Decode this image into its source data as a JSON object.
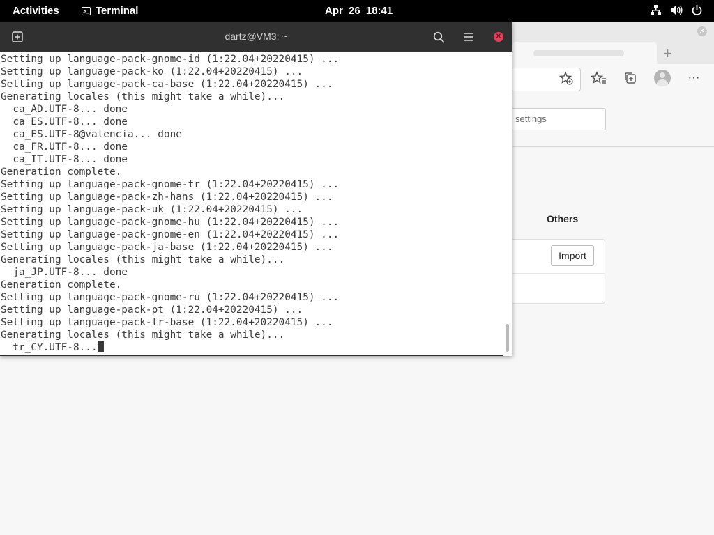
{
  "topbar": {
    "activities": "Activities",
    "app_name": "Terminal",
    "clock": "Apr 26  18:41"
  },
  "browser": {
    "search_placeholder": "settings",
    "section_label": "Others",
    "import_label": "Import"
  },
  "terminal": {
    "title": "dartz@VM3: ~",
    "lines": [
      "Setting up language-pack-gnome-id (1:22.04+20220415) ...",
      "Setting up language-pack-ko (1:22.04+20220415) ...",
      "Setting up language-pack-ca-base (1:22.04+20220415) ...",
      "Generating locales (this might take a while)...",
      "  ca_AD.UTF-8... done",
      "  ca_ES.UTF-8... done",
      "  ca_ES.UTF-8@valencia... done",
      "  ca_FR.UTF-8... done",
      "  ca_IT.UTF-8... done",
      "Generation complete.",
      "Setting up language-pack-gnome-tr (1:22.04+20220415) ...",
      "Setting up language-pack-zh-hans (1:22.04+20220415) ...",
      "Setting up language-pack-uk (1:22.04+20220415) ...",
      "Setting up language-pack-gnome-hu (1:22.04+20220415) ...",
      "Setting up language-pack-gnome-en (1:22.04+20220415) ...",
      "Setting up language-pack-ja-base (1:22.04+20220415) ...",
      "Generating locales (this might take a while)...",
      "  ja_JP.UTF-8... done",
      "Generation complete.",
      "Setting up language-pack-gnome-ru (1:22.04+20220415) ...",
      "Setting up language-pack-pt (1:22.04+20220415) ...",
      "Setting up language-pack-tr-base (1:22.04+20220415) ...",
      "Generating locales (this might take a while)...",
      "  tr_CY.UTF-8..."
    ]
  },
  "colors": {
    "topbar_bg": "#000000",
    "headerbar_bg": "#303030",
    "close_button": "#e0405a",
    "terminal_text": "#3a3a3a"
  },
  "icons": [
    "new-tab-icon",
    "search-icon",
    "hamburger-menu-icon",
    "close-icon",
    "network-icon",
    "volume-icon",
    "power-icon",
    "terminal-icon",
    "favorite-add-icon",
    "favorites-icon",
    "collections-icon",
    "profile-icon",
    "more-icon"
  ]
}
